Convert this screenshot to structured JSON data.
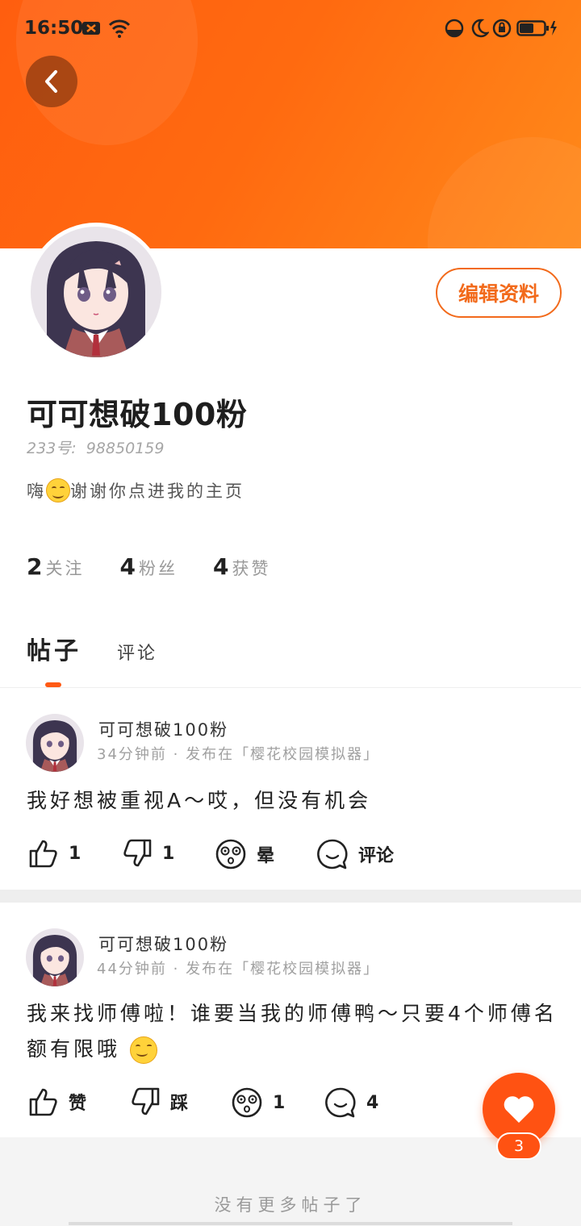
{
  "status_bar": {
    "time": "16:50"
  },
  "profile": {
    "edit_label": "编辑资料",
    "nickname": "可可想破100粉",
    "uid_label": "233号:",
    "uid_value": "98850159",
    "bio_prefix": "嗨",
    "bio_text": "谢谢你点进我的主页",
    "stats": [
      {
        "value": "2",
        "label": "关注"
      },
      {
        "value": "4",
        "label": "粉丝"
      },
      {
        "value": "4",
        "label": "获赞"
      }
    ]
  },
  "tabs": {
    "active": "帖子",
    "other": "评论"
  },
  "posts": [
    {
      "author": "可可想破100粉",
      "meta": "34分钟前 · 发布在「樱花校园模拟器」",
      "text": "我好想被重视A～哎，但没有机会",
      "actions": {
        "like": "1",
        "dislike": "1",
        "dizzy": "晕",
        "comment": "评论"
      }
    },
    {
      "author": "可可想破100粉",
      "meta": "44分钟前 · 发布在「樱花校园模拟器」",
      "text": "我来找师傅啦！谁要当我的师傅鸭～只要4个师傅名额有限哦",
      "actions": {
        "like": "赞",
        "dislike": "踩",
        "dizzy": "1",
        "comment": "4"
      }
    }
  ],
  "footer": {
    "no_more": "没有更多帖子了"
  },
  "fab": {
    "like_count": "3"
  },
  "colors": {
    "accent": "#ff5a14",
    "header_gradient_start": "#ff5e0f",
    "header_gradient_end": "#ff8a1a"
  }
}
